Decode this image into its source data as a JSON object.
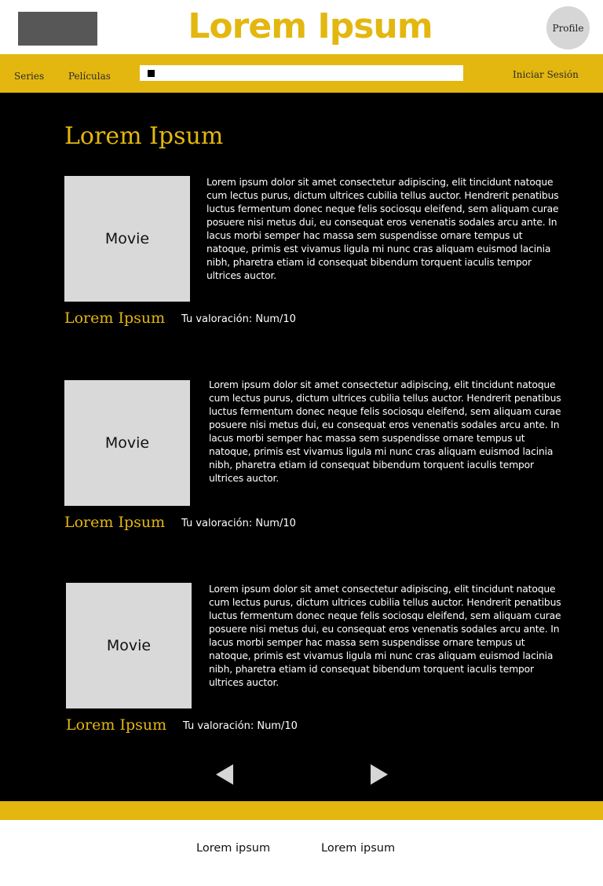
{
  "header": {
    "brand": "Lorem Ipsum",
    "profile_label": "Profile"
  },
  "nav": {
    "series": "Series",
    "peliculas": "Películas",
    "login": "Iniciar Sesión",
    "search_value": ""
  },
  "main": {
    "section_title": "Lorem Ipsum",
    "movies": [
      {
        "poster_label": "Movie",
        "description": "Lorem ipsum dolor sit amet consectetur adipiscing, elit tincidunt natoque cum lectus purus, dictum ultrices cubilia tellus auctor. Hendrerit penatibus luctus fermentum donec neque felis sociosqu eleifend, sem aliquam curae posuere nisi metus dui, eu consequat eros venenatis sodales arcu ante. In lacus morbi semper hac massa sem suspendisse ornare tempus ut natoque, primis est vivamus ligula mi nunc cras aliquam euismod lacinia nibh, pharetra etiam id consequat bibendum torquent iaculis tempor ultrices auctor.",
        "title": "Lorem Ipsum",
        "rating": "Tu valoración: Num/10"
      },
      {
        "poster_label": "Movie",
        "description": "Lorem ipsum dolor sit amet consectetur adipiscing, elit tincidunt natoque cum lectus purus, dictum ultrices cubilia tellus auctor. Hendrerit penatibus luctus fermentum donec neque felis sociosqu eleifend, sem aliquam curae posuere nisi metus dui, eu consequat eros venenatis sodales arcu ante. In lacus morbi semper hac massa sem suspendisse ornare tempus ut natoque, primis est vivamus ligula mi nunc cras aliquam euismod lacinia nibh, pharetra etiam id consequat bibendum torquent iaculis tempor ultrices auctor.",
        "title": "Lorem Ipsum",
        "rating": "Tu valoración: Num/10"
      },
      {
        "poster_label": "Movie",
        "description": "Lorem ipsum dolor sit amet consectetur adipiscing, elit tincidunt natoque cum lectus purus, dictum ultrices cubilia tellus auctor. Hendrerit penatibus luctus fermentum donec neque felis sociosqu eleifend, sem aliquam curae posuere nisi metus dui, eu consequat eros venenatis sodales arcu ante. In lacus morbi semper hac massa sem suspendisse ornare tempus ut natoque, primis est vivamus ligula mi nunc cras aliquam euismod lacinia nibh, pharetra etiam id consequat bibendum torquent iaculis tempor ultrices auctor.",
        "title": "Lorem Ipsum",
        "rating": "Tu valoración: Num/10"
      }
    ]
  },
  "pagination": {
    "prev_icon": "triangle-left-icon",
    "next_icon": "triangle-right-icon"
  },
  "footer": {
    "links": [
      "Lorem ipsum",
      "Lorem ipsum"
    ]
  },
  "colors": {
    "accent": "#e3b70f",
    "background": "#000000",
    "poster": "#d9d9d9",
    "logo_placeholder": "#575757",
    "profile_circle": "#d6d6d6"
  }
}
